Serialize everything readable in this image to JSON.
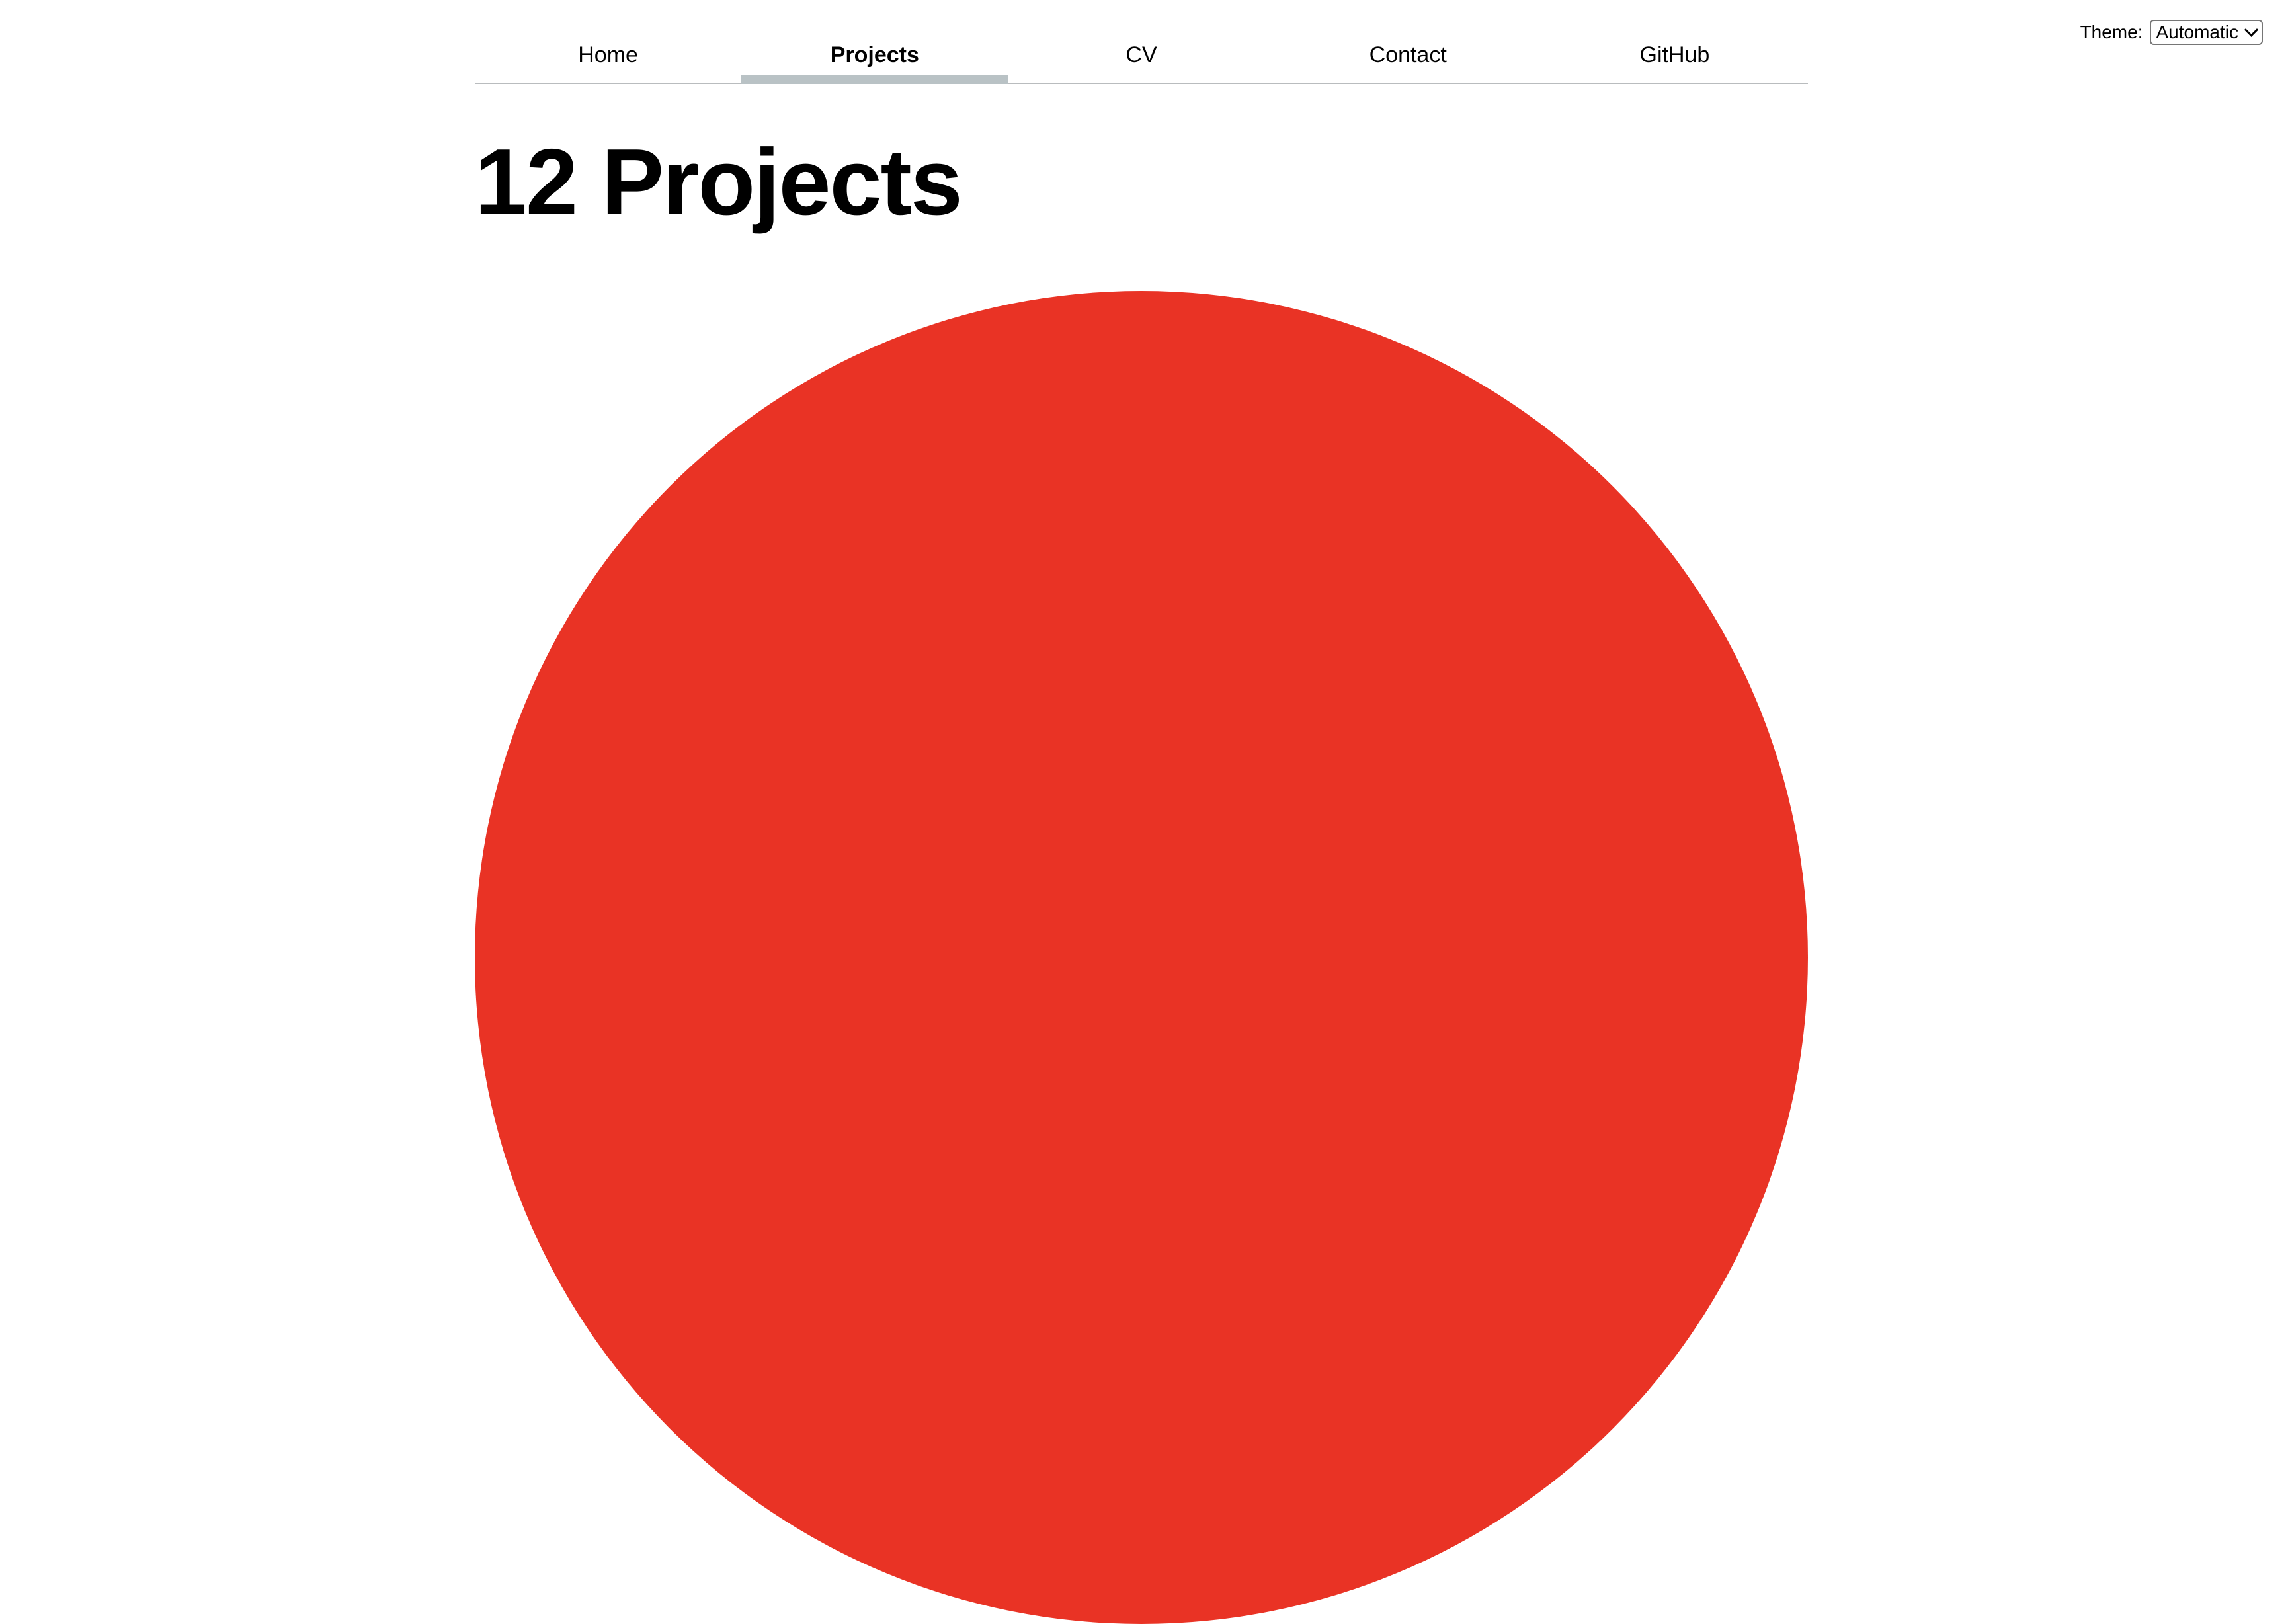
{
  "theme_control": {
    "label": "Theme:",
    "selected": "Automatic"
  },
  "nav": {
    "items": [
      {
        "label": "Home",
        "active": false
      },
      {
        "label": "Projects",
        "active": true
      },
      {
        "label": "CV",
        "active": false
      },
      {
        "label": "Contact",
        "active": false
      },
      {
        "label": "GitHub",
        "active": false
      }
    ]
  },
  "main": {
    "title": "12 Projects"
  },
  "colors": {
    "circle": "#e93325",
    "active_indicator": "#b9c2c5",
    "nav_border": "#b9bcbe"
  }
}
